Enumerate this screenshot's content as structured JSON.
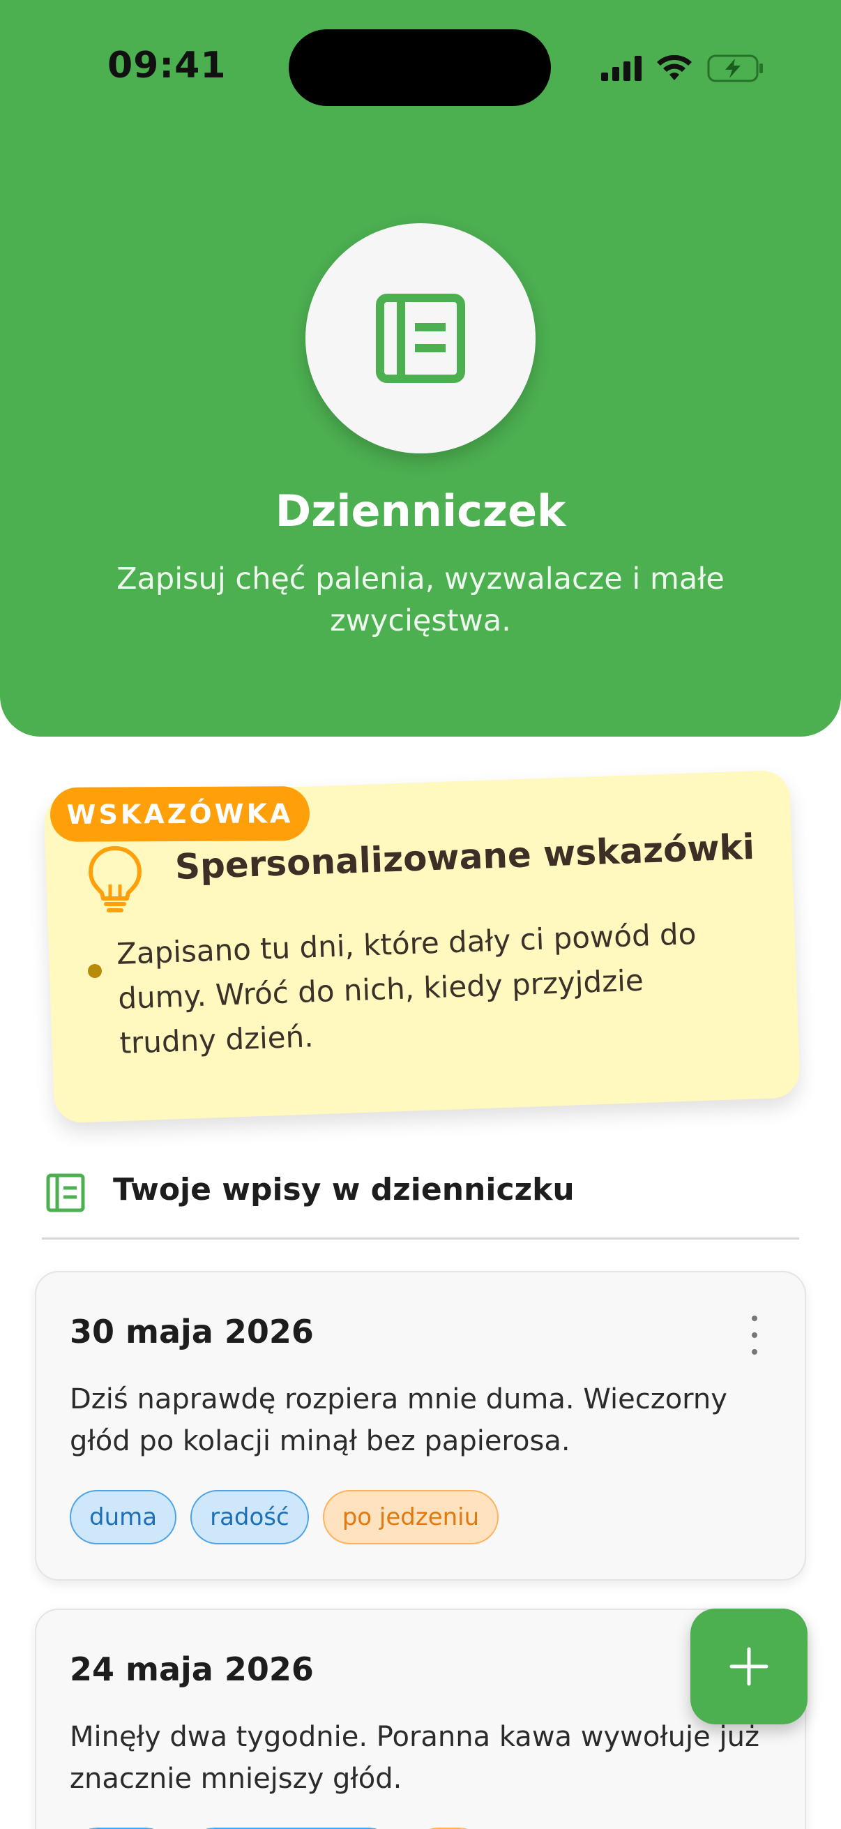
{
  "status_bar": {
    "time": "09:41"
  },
  "header": {
    "logo_icon": "journal-icon",
    "title": "Dzienniczek",
    "subtitle": "Zapisuj chęć palenia, wyzwalacze i małe zwycięstwa."
  },
  "tip": {
    "badge": "WSKAZÓWKA",
    "icon": "lightbulb-icon",
    "title": "Spersonalizowane wskazówki",
    "text": "Zapisano tu dni, które dały ci powód do dumy. Wróć do nich, kiedy przyjdzie trudny dzień."
  },
  "entries_section": {
    "icon": "journal-icon",
    "title": "Twoje wpisy w dzienniczku"
  },
  "entries": [
    {
      "date": "30 maja 2026",
      "text": "Dziś naprawdę rozpiera mnie duma. Wieczorny głód po kolacji minął bez papierosa.",
      "tags": [
        {
          "label": "duma",
          "color": "blue"
        },
        {
          "label": "radość",
          "color": "blue"
        },
        {
          "label": "po jedzeniu",
          "color": "orange"
        }
      ]
    },
    {
      "date": "24 maja 2026",
      "text": "Minęły dwa tygodnie. Poranna kawa wywołuje już znacznie mniejszy głód."
    }
  ],
  "fab": {
    "icon": "plus-icon"
  },
  "colors": {
    "primary": "#4caf50",
    "tip_background": "#fff8bf",
    "badge": "#ff9f0a"
  }
}
